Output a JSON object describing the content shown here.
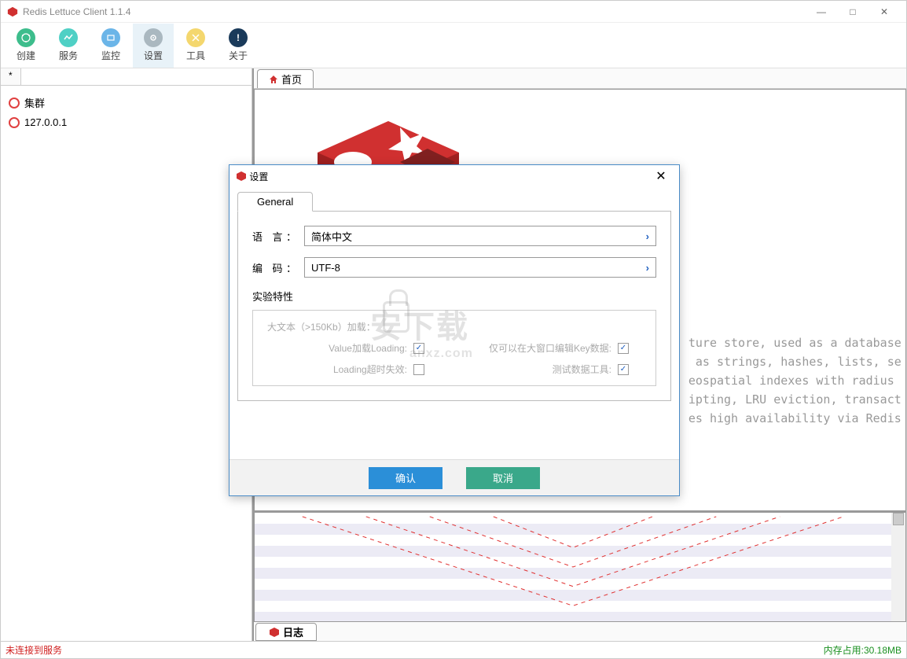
{
  "app": {
    "title": "Redis Lettuce Client 1.1.4"
  },
  "toolbar": {
    "items": [
      {
        "label": "创建",
        "name": "create-button",
        "iconClass": "tb-icon-green"
      },
      {
        "label": "服务",
        "name": "services-button",
        "iconClass": "tb-icon-teal"
      },
      {
        "label": "监控",
        "name": "monitor-button",
        "iconClass": "tb-icon-blue"
      },
      {
        "label": "设置",
        "name": "settings-button",
        "iconClass": "tb-icon-gray",
        "active": true
      },
      {
        "label": "工具",
        "name": "tools-button",
        "iconClass": "tb-icon-yellow"
      },
      {
        "label": "关于",
        "name": "about-button",
        "iconClass": "tb-icon-dark",
        "glyph": "!"
      }
    ]
  },
  "sidebar": {
    "tab": "*",
    "tree": [
      {
        "label": "集群",
        "name": "tree-cluster"
      },
      {
        "label": "127.0.0.1",
        "name": "tree-host-local"
      }
    ]
  },
  "contentTabs": {
    "home": "首页"
  },
  "redisDescription": "                                                            ture store, used as a database\n                                                             as strings, hashes, lists, se\n                                                            eospatial indexes with radius \n                                                            ipting, LRU eviction, transact\n                                                            es high availability via Redis",
  "logTab": "日志",
  "status": {
    "left": "未连接到服务",
    "right": "内存占用:30.18MB"
  },
  "dialog": {
    "title": "设置",
    "tab": "General",
    "language": {
      "label": "语 言：",
      "value": "简体中文"
    },
    "encoding": {
      "label": "编 码：",
      "value": "UTF-8"
    },
    "experimental": {
      "title": "实验特性",
      "largeTextLabel": "大文本（>150Kb）加载：",
      "ck1": {
        "label": "Value加载Loading:",
        "checked": true
      },
      "ck2": {
        "label": "Loading超时失效:",
        "checked": false
      },
      "ck3": {
        "label": "仅可以在大窗口编辑Key数据:",
        "checked": true
      },
      "ck4": {
        "label": "测试数据工具:",
        "checked": true
      }
    },
    "ok": "确认",
    "cancel": "取消"
  },
  "watermark": {
    "main": "安下载",
    "sub": "anxz.com"
  }
}
